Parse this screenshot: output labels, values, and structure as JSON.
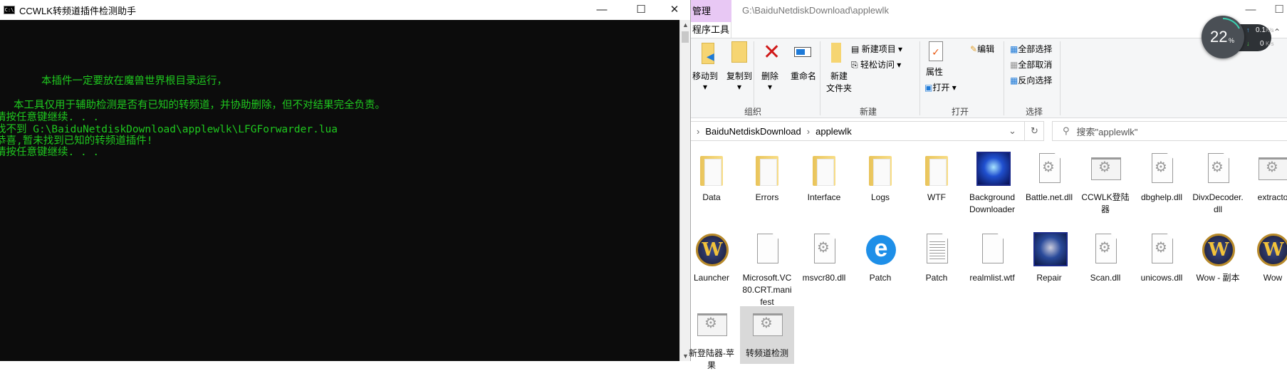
{
  "console": {
    "title": "CCWLK转频道插件检测助手",
    "lines": [
      "本插件一定要放在魔兽世界根目录运行，",
      "本工具仅用于辅助检测是否有已知的转频道，并协助删除，但不对结果完全负责。",
      "请按任意键继续. . .",
      "找不到 G:\\BaiduNetdiskDownload\\applewlk\\LFGForwarder.lua",
      "恭喜,暂未找到已知的转频道插件!",
      "请按任意键继续. . ."
    ],
    "text_color": "#1fc81f"
  },
  "explorer": {
    "manage_tab": "管理",
    "tools_tab": "程序工具",
    "title_path": "G:\\BaiduNetdiskDownload\\applewlk",
    "ribbon": {
      "move_to": "移动到",
      "copy_to": "复制到",
      "delete": "删除",
      "rename": "重命名",
      "new_folder": "新建\n文件夹",
      "new_item": "新建项目",
      "easy_access": "轻松访问",
      "properties": "属性",
      "open": "打开",
      "edit": "编辑",
      "select_all": "全部选择",
      "select_none": "全部取消",
      "invert_selection": "反向选择",
      "group_organize": "组织",
      "group_new": "新建",
      "group_open": "打开",
      "group_select": "选择"
    },
    "breadcrumb": [
      "BaiduNetdiskDownload",
      "applewlk"
    ],
    "search_placeholder": "搜索\"applewlk\"",
    "files": [
      {
        "label": "Data",
        "icon": "folder"
      },
      {
        "label": "Errors",
        "icon": "folder"
      },
      {
        "label": "Interface",
        "icon": "folder"
      },
      {
        "label": "Logs",
        "icon": "folder"
      },
      {
        "label": "WTF",
        "icon": "folder"
      },
      {
        "label": "BackgroundDownloader",
        "icon": "image"
      },
      {
        "label": "Battle.net.dll",
        "icon": "gear-file"
      },
      {
        "label": "CCWLK登陆器",
        "icon": "app"
      },
      {
        "label": "dbghelp.dll",
        "icon": "gear-file"
      },
      {
        "label": "DivxDecoder.dll",
        "icon": "gear-file"
      },
      {
        "label": "extracto",
        "icon": "app"
      },
      {
        "label": "Launcher",
        "icon": "wow"
      },
      {
        "label": "Microsoft.VC80.CRT.manifest",
        "icon": "blank"
      },
      {
        "label": "msvcr80.dll",
        "icon": "gear-file"
      },
      {
        "label": "Patch",
        "icon": "ie"
      },
      {
        "label": "Patch",
        "icon": "text"
      },
      {
        "label": "realmlist.wtf",
        "icon": "blank"
      },
      {
        "label": "Repair",
        "icon": "repair"
      },
      {
        "label": "Scan.dll",
        "icon": "gear-file"
      },
      {
        "label": "unicows.dll",
        "icon": "gear-file"
      },
      {
        "label": "Wow - 副本",
        "icon": "wow"
      },
      {
        "label": "Wow",
        "icon": "wow"
      },
      {
        "label": "新登陆器-苹果",
        "icon": "app"
      },
      {
        "label": "转频道检测",
        "icon": "app",
        "selected": true
      }
    ]
  },
  "net_widget": {
    "cpu": "22",
    "cpu_unit": "%",
    "up": "0.1",
    "down": "0",
    "unit": "K/s",
    "cpu_level_percent": 22
  }
}
